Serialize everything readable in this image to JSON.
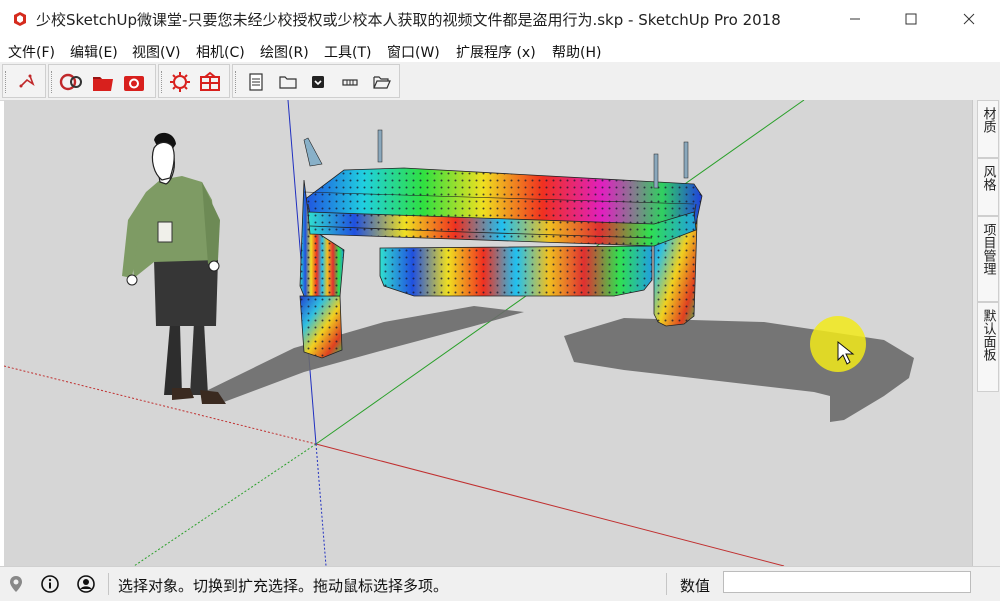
{
  "window": {
    "title": "少校SketchUp微课堂-只要您未经少校授权或少校本人获取的视频文件都是盗用行为.skp - SketchUp Pro 2018"
  },
  "menu": {
    "items": [
      {
        "label": "文件(F)"
      },
      {
        "label": "编辑(E)"
      },
      {
        "label": "视图(V)"
      },
      {
        "label": "相机(C)"
      },
      {
        "label": "绘图(R)"
      },
      {
        "label": "工具(T)"
      },
      {
        "label": "窗口(W)"
      },
      {
        "label": "扩展程序 (x)"
      },
      {
        "label": "帮助(H)"
      }
    ]
  },
  "tray": {
    "tabs": [
      {
        "label": "材质"
      },
      {
        "label": "风格"
      },
      {
        "label": "项目管理"
      },
      {
        "label": "默认面板"
      }
    ]
  },
  "status": {
    "message": "选择对象。切换到扩充选择。拖动鼠标选择多项。",
    "measurements_label": "数值",
    "measurements_value": ""
  },
  "colors": {
    "viewport_bg": "#d6d6d6",
    "axis_red": "#c03030",
    "axis_green": "#2aa02a",
    "axis_blue": "#2030c0",
    "cursor_highlight": "#f2ea1a"
  }
}
